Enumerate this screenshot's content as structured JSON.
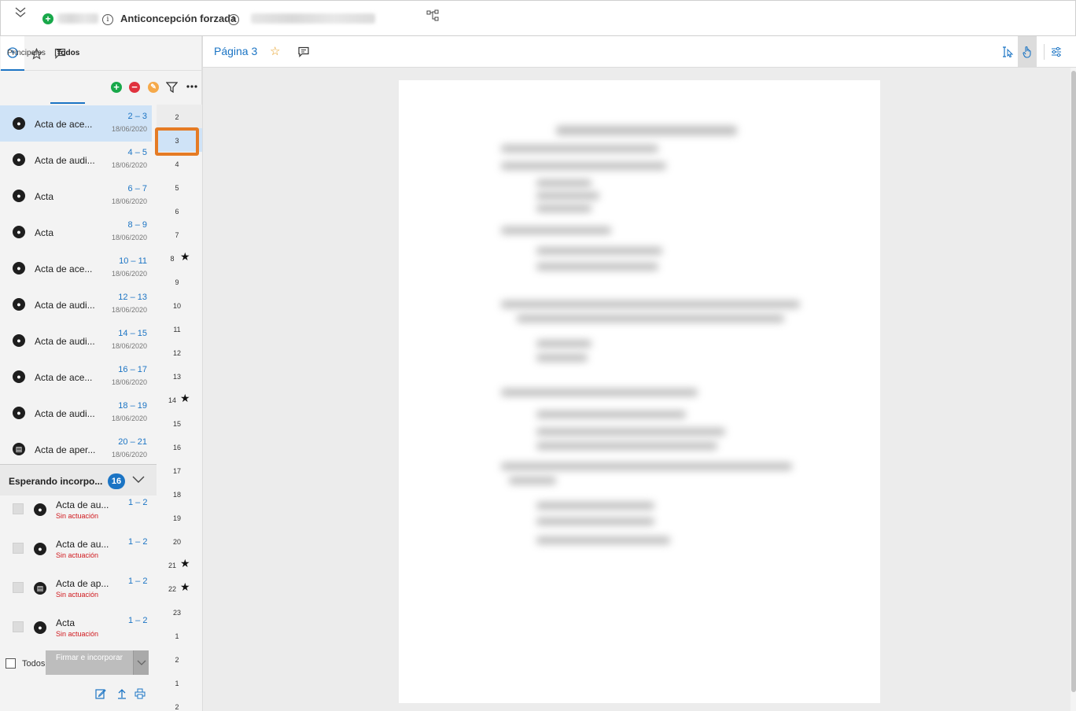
{
  "topbar": {
    "title": "Anticoncepción forzada",
    "add_icon": "plus-circle-icon",
    "info_icon": "info-icon",
    "tree_icon": "tree-structure-icon"
  },
  "left_tabs": [
    "clock-icon",
    "star-icon",
    "comment-icon"
  ],
  "subtabs": {
    "principales": "Principales",
    "todos": "Todos"
  },
  "documents": [
    {
      "title": "Acta de ace...",
      "range": "2 – 3",
      "date": "18/06/2020",
      "selected": true
    },
    {
      "title": "Acta de audi...",
      "range": "4 – 5",
      "date": "18/06/2020"
    },
    {
      "title": "Acta",
      "range": "6 – 7",
      "date": "18/06/2020"
    },
    {
      "title": "Acta",
      "range": "8 – 9",
      "date": "18/06/2020"
    },
    {
      "title": "Acta de ace...",
      "range": "10 – 11",
      "date": "18/06/2020"
    },
    {
      "title": "Acta de audi...",
      "range": "12 – 13",
      "date": "18/06/2020"
    },
    {
      "title": "Acta de audi...",
      "range": "14 – 15",
      "date": "18/06/2020"
    },
    {
      "title": "Acta de ace...",
      "range": "16 – 17",
      "date": "18/06/2020"
    },
    {
      "title": "Acta de audi...",
      "range": "18 – 19",
      "date": "18/06/2020"
    },
    {
      "title": "Acta de aper...",
      "range": "20 – 21",
      "date": "18/06/2020"
    }
  ],
  "pending": {
    "title": "Esperando incorpo...",
    "count": "16",
    "items": [
      {
        "title": "Acta de au...",
        "status": "Sin actuación",
        "range": "1 – 2"
      },
      {
        "title": "Acta de au...",
        "status": "Sin actuación",
        "range": "1 – 2"
      },
      {
        "title": "Acta de ap...",
        "status": "Sin actuación",
        "range": "1 – 2"
      },
      {
        "title": "Acta",
        "status": "Sin actuación",
        "range": "1 – 2"
      }
    ],
    "todos_label": "Todos",
    "sign_button": "Firmar e incorporar"
  },
  "pages": [
    {
      "n": "2"
    },
    {
      "n": "3",
      "selected": true
    },
    {
      "n": "4"
    },
    {
      "n": "5"
    },
    {
      "n": "6"
    },
    {
      "n": "7"
    },
    {
      "n": "8",
      "star": true
    },
    {
      "n": "9"
    },
    {
      "n": "10"
    },
    {
      "n": "11"
    },
    {
      "n": "12"
    },
    {
      "n": "13"
    },
    {
      "n": "14",
      "star": true
    },
    {
      "n": "15"
    },
    {
      "n": "16"
    },
    {
      "n": "17"
    },
    {
      "n": "18"
    },
    {
      "n": "19"
    },
    {
      "n": "20"
    },
    {
      "n": "21",
      "star": true
    },
    {
      "n": "22",
      "star": true
    },
    {
      "n": "23"
    },
    {
      "n": "1"
    },
    {
      "n": "2"
    },
    {
      "n": "1"
    },
    {
      "n": "2"
    }
  ],
  "viewer": {
    "page_label": "Página 3",
    "tools": [
      "text-select-icon",
      "hand-pointer-icon",
      "settings-sliders-icon"
    ]
  }
}
